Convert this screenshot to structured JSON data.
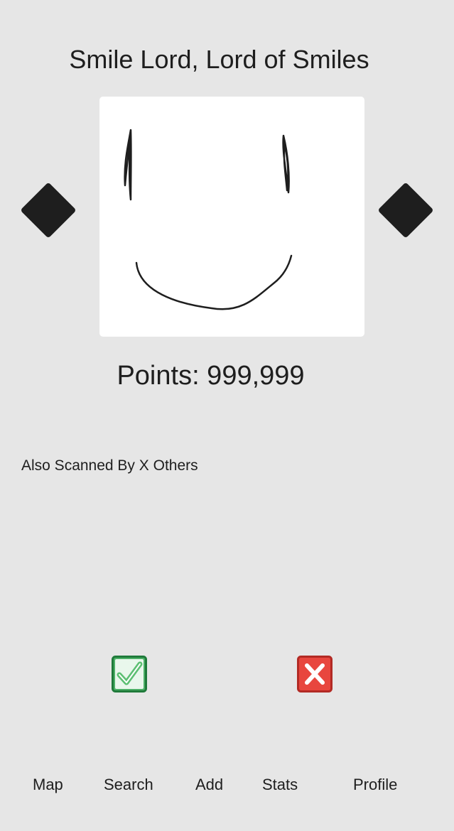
{
  "header": {
    "title": "Smile Lord, Lord of Smiles"
  },
  "card": {
    "points_text": "Points: 999,999",
    "also_scanned_text": "Also Scanned By X Others"
  },
  "actions": {
    "accept_icon": "check-mark-icon",
    "reject_icon": "cross-mark-icon",
    "accept_color": "#3fa55a",
    "reject_color": "#e8463e"
  },
  "tabs": [
    {
      "label": "Map"
    },
    {
      "label": "Search"
    },
    {
      "label": "Add"
    },
    {
      "label": "Stats"
    },
    {
      "label": "Profile"
    }
  ],
  "colors": {
    "background": "#e6e6e6",
    "ink": "#1e1e1e",
    "card": "#ffffff"
  }
}
